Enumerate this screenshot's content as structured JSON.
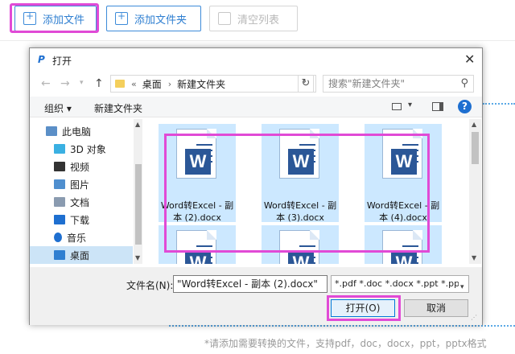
{
  "toolbar": {
    "add_file": "添加文件",
    "add_folder": "添加文件夹",
    "clear_list": "清空列表"
  },
  "hint": "*请添加需要转换的文件，支持pdf，doc，docx，ppt，pptx格式",
  "dialog": {
    "title": "打开",
    "breadcrumb": [
      "«",
      "桌面",
      "›",
      "新建文件夹"
    ],
    "search_placeholder": "搜索\"新建文件夹\"",
    "commands": {
      "organize": "组织 ▾",
      "new_folder": "新建文件夹"
    },
    "sidebar": [
      {
        "label": "此电脑",
        "icon": "computer-icon",
        "color": "#5b8fc7"
      },
      {
        "label": "3D 对象",
        "icon": "cube-3d-icon",
        "color": "#3ab0e2"
      },
      {
        "label": "视频",
        "icon": "video-icon",
        "color": "#333333"
      },
      {
        "label": "图片",
        "icon": "picture-icon",
        "color": "#4f8fcf"
      },
      {
        "label": "文档",
        "icon": "document-icon",
        "color": "#8a9bb0"
      },
      {
        "label": "下载",
        "icon": "download-icon",
        "color": "#1e6fd0"
      },
      {
        "label": "音乐",
        "icon": "music-icon",
        "color": "#1e6fd0"
      },
      {
        "label": "桌面",
        "icon": "desktop-icon",
        "color": "#2f7fd1"
      }
    ],
    "files": [
      {
        "name": "Word转Excel - 副本 (2).docx",
        "badge": "W"
      },
      {
        "name": "Word转Excel - 副本 (3).docx",
        "badge": "W"
      },
      {
        "name": "Word转Excel - 副本 (4).docx",
        "badge": "W"
      },
      {
        "name": "",
        "badge": "W"
      },
      {
        "name": "",
        "badge": "W"
      },
      {
        "name": "",
        "badge": "W"
      }
    ],
    "filename_label": "文件名(N):",
    "filename_value": "\"Word转Excel - 副本 (2).docx\"",
    "filetype_value": "*.pdf *.doc *.docx *.ppt *.ppt",
    "open_button": "打开(O)",
    "cancel_button": "取消"
  },
  "colors": {
    "accent": "#3d8bd9",
    "highlight": "#e14ad6",
    "word_blue": "#2b5797",
    "selection": "#cce8ff"
  }
}
